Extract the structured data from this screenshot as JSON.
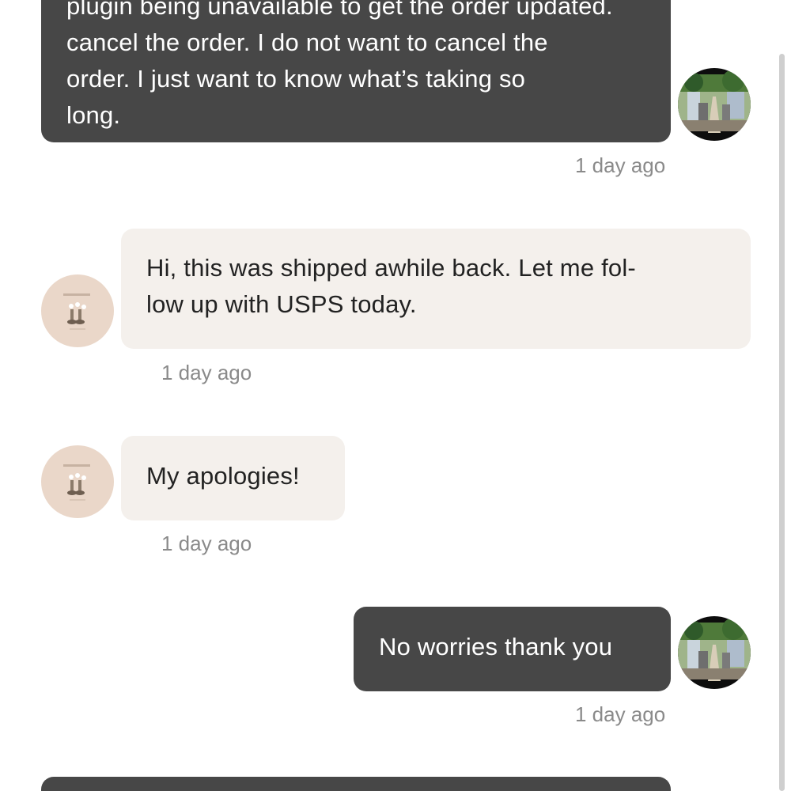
{
  "conversation": {
    "messages": [
      {
        "sender": "me",
        "partial_top_line": "plugin being unavailable to get the order updated.",
        "lines": [
          "cancel the order. I do not want to cancel the",
          "order. I just want to know what’s taking so",
          "long."
        ],
        "time": "1 day ago"
      },
      {
        "sender": "shop",
        "lines": [
          "Hi, this was shipped awhile back. Let me fol-",
          "low up with USPS today."
        ],
        "time": "1 day ago"
      },
      {
        "sender": "shop",
        "lines": [
          "My apologies!"
        ],
        "time": "1 day ago"
      },
      {
        "sender": "me",
        "lines": [
          "No worries thank you"
        ],
        "time": "1 day ago"
      },
      {
        "sender": "me",
        "lines": []
      }
    ]
  },
  "avatars": {
    "me": "street-photo-avatar",
    "shop": "shop-logo-avatar"
  },
  "colors": {
    "outgoing_bubble": "#474747",
    "incoming_bubble": "#f4f0ec",
    "timestamp": "#8a8a8a",
    "shop_avatar_bg": "#ead7c9"
  }
}
